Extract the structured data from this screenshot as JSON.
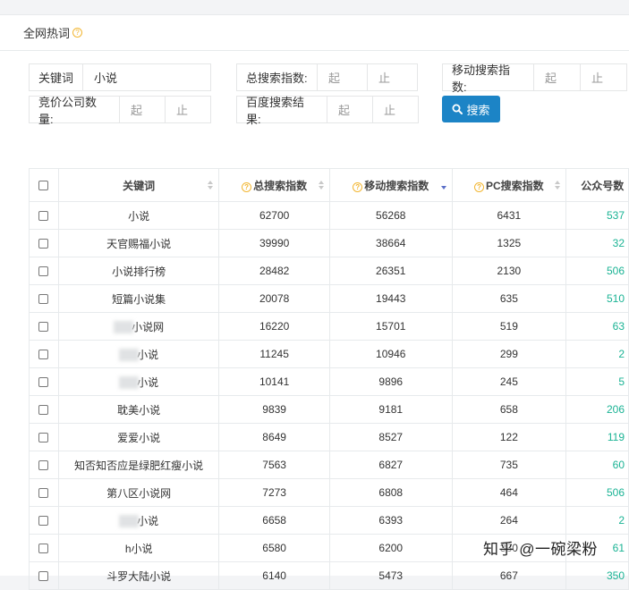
{
  "panel": {
    "title": "全网热词",
    "help_icon": "question-circle-icon"
  },
  "filters": {
    "keyword": {
      "label": "关键词",
      "value": "小说"
    },
    "total_index": {
      "label": "总搜索指数:",
      "from_placeholder": "起",
      "to_placeholder": "止"
    },
    "mobile_index": {
      "label": "移动搜索指数:",
      "from_placeholder": "起",
      "to_placeholder": "止"
    },
    "bid_companies": {
      "label": "竞价公司数量:",
      "from_placeholder": "起",
      "to_placeholder": "止"
    },
    "baidu_results": {
      "label": "百度搜索结果:",
      "from_placeholder": "起",
      "to_placeholder": "止"
    },
    "search_button": {
      "label": "搜索",
      "icon": "search-icon"
    }
  },
  "table": {
    "headers": [
      "关键词",
      "总搜索指数",
      "移动搜索指数",
      "PC搜索指数",
      "公众号数"
    ],
    "sorted_column": "移动搜索指数",
    "rows": [
      {
        "keyword": "小说",
        "total": "62700",
        "mobile": "56268",
        "pc": "6431",
        "accounts": "537"
      },
      {
        "keyword": "天官赐福小说",
        "total": "39990",
        "mobile": "38664",
        "pc": "1325",
        "accounts": "32"
      },
      {
        "keyword": "小说排行榜",
        "total": "28482",
        "mobile": "26351",
        "pc": "2130",
        "accounts": "506"
      },
      {
        "keyword": "短篇小说集",
        "total": "20078",
        "mobile": "19443",
        "pc": "635",
        "accounts": "510"
      },
      {
        "keyword": "小说网",
        "total": "16220",
        "mobile": "15701",
        "pc": "519",
        "accounts": "63",
        "blurred": true
      },
      {
        "keyword": "小说",
        "total": "11245",
        "mobile": "10946",
        "pc": "299",
        "accounts": "2",
        "blurred": true
      },
      {
        "keyword": "小说",
        "total": "10141",
        "mobile": "9896",
        "pc": "245",
        "accounts": "5",
        "blurred": true
      },
      {
        "keyword": "耽美小说",
        "total": "9839",
        "mobile": "9181",
        "pc": "658",
        "accounts": "206"
      },
      {
        "keyword": "爱爱小说",
        "total": "8649",
        "mobile": "8527",
        "pc": "122",
        "accounts": "119"
      },
      {
        "keyword": "知否知否应是绿肥红瘦小说",
        "total": "7563",
        "mobile": "6827",
        "pc": "735",
        "accounts": "60"
      },
      {
        "keyword": "第八区小说网",
        "total": "7273",
        "mobile": "6808",
        "pc": "464",
        "accounts": "506"
      },
      {
        "keyword": "小说",
        "total": "6658",
        "mobile": "6393",
        "pc": "264",
        "accounts": "2",
        "blurred": true
      },
      {
        "keyword": "h小说",
        "total": "6580",
        "mobile": "6200",
        "pc": "380",
        "accounts": "61"
      },
      {
        "keyword": "斗罗大陆小说",
        "total": "6140",
        "mobile": "5473",
        "pc": "667",
        "accounts": "350"
      }
    ]
  },
  "watermark": "知乎 @一碗梁粉"
}
